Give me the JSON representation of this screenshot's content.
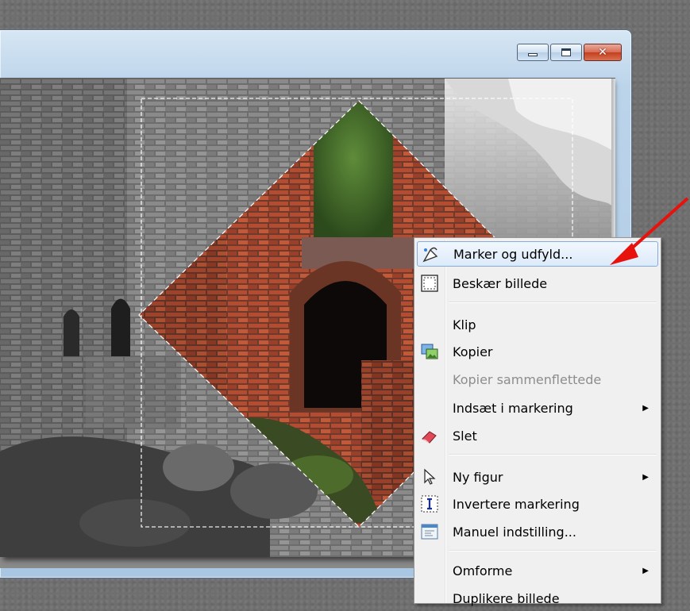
{
  "window": {
    "controls": {
      "minimize": "minimize-icon",
      "maximize": "maximize-icon",
      "close": "close-icon",
      "close_glyph": "✕"
    }
  },
  "context_menu": {
    "items": [
      {
        "label": "Marker og udfyld...",
        "icon": "magic-fill-icon",
        "highlighted": true
      },
      {
        "label": "Beskær billede",
        "icon": "crop-icon"
      },
      {
        "label": "Klip"
      },
      {
        "label": "Kopier",
        "icon": "copy-image-icon"
      },
      {
        "label": "Kopier sammenflettede",
        "disabled": true
      },
      {
        "label": "Indsæt i markering",
        "submenu": true
      },
      {
        "label": "Slet",
        "icon": "eraser-icon"
      },
      {
        "label": "Ny figur",
        "icon": "pointer-icon",
        "submenu": true
      },
      {
        "label": "Invertere markering",
        "icon": "invert-selection-icon"
      },
      {
        "label": "Manuel indstilling...",
        "icon": "settings-window-icon"
      },
      {
        "label": "Omforme",
        "submenu": true
      },
      {
        "label": "Duplikere billede"
      }
    ],
    "submenu_arrow": "▶"
  },
  "annotation": {
    "color": "#e8120c",
    "icon": "red-arrow-icon"
  },
  "colors": {
    "highlight_border": "#84acdd",
    "brick": "#a8442c",
    "selection": "#ffffff"
  }
}
